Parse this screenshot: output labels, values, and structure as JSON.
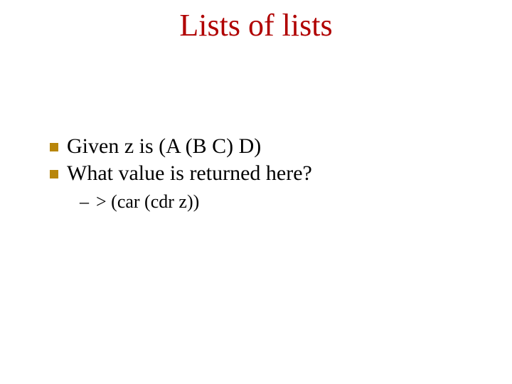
{
  "title": "Lists of lists",
  "bullets": [
    "Given z is (A  (B  C)  D)",
    "What value is returned here?"
  ],
  "sub": "> (car  (cdr  z))",
  "dash": "–"
}
